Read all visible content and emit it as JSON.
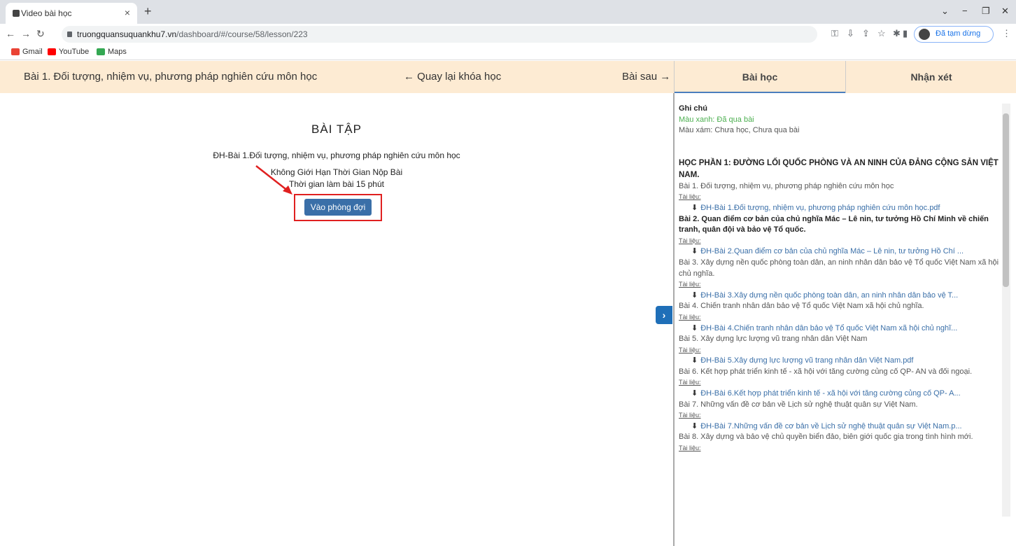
{
  "browser": {
    "tab_title": "Video bài học",
    "tab_close": "×",
    "new_tab": "+",
    "url_host": "truongquansuquankhu7.vn",
    "url_path": "/dashboard/#/course/58/lesson/223",
    "paused_label": "Đã tạm dừng",
    "bookmarks": [
      "Gmail",
      "YouTube",
      "Maps"
    ],
    "window_controls": [
      "⌄",
      "−",
      "❐",
      "✕"
    ]
  },
  "header": {
    "lesson_title": "Bài 1. Đối tượng, nhiệm vụ, phương pháp nghiên cứu môn học",
    "back_label": "← Quay lại khóa học",
    "next_label": "Bài sau →"
  },
  "right_tabs": {
    "lesson": "Bài học",
    "comments": "Nhận xét"
  },
  "exercise": {
    "heading": "BÀI TẬP",
    "name": "ĐH-Bài 1.Đối tượng, nhiệm vụ, phương pháp nghiên cứu môn học",
    "limit": "Không Giới Hạn Thời Gian Nộp Bài",
    "duration": "Thời gian làm bài 15 phút",
    "enter_button": "Vào phòng đợi"
  },
  "panel": {
    "note_title": "Ghi chú",
    "note_green": "Màu xanh: Đã qua bài",
    "note_gray": "Màu xám: Chưa học, Chưa qua bài",
    "module": "HỌC PHẦN 1: ĐƯỜNG LỐI QUỐC PHÒNG VÀ AN NINH CỦA ĐẢNG CỘNG SẢN VIỆT NAM.",
    "doc_label": "Tài liệu:",
    "lessons": [
      {
        "title": "Bài 1. Đối tượng, nhiệm vụ, phương pháp nghiên cứu môn học",
        "file": "ĐH-Bài 1.Đối tượng, nhiệm vụ, phương pháp nghiên cứu môn học.pdf"
      },
      {
        "title": "Bài 2. Quan điểm cơ bản của chủ nghĩa Mác – Lê nin, tư tưởng Hồ Chí Minh về chiến tranh, quân đội và bảo vệ Tổ quốc.",
        "file": "ĐH-Bài 2.Quan điểm cơ bản của chủ nghĩa Mác – Lê nin, tư tưởng Hồ Chí ..."
      },
      {
        "title": "Bài 3. Xây dựng nền quốc phòng toàn dân, an ninh nhân dân bảo vệ Tổ quốc Việt Nam xã hội chủ nghĩa.",
        "file": "ĐH-Bài 3.Xây dựng nền quốc phòng toàn dân, an ninh nhân dân bảo vệ T..."
      },
      {
        "title": "Bài 4. Chiến tranh nhân dân bảo vệ Tổ quốc Việt Nam xã hội chủ nghĩa.",
        "file": "ĐH-Bài 4.Chiến tranh nhân dân bảo vệ Tổ quốc Việt Nam xã hội chủ nghĩ..."
      },
      {
        "title": "Bài 5. Xây dựng lực lượng vũ trang nhân dân Việt Nam",
        "file": "ĐH-Bài 5.Xây dựng lực lượng vũ trang nhân dân Việt Nam.pdf"
      },
      {
        "title": "Bài 6. Kết hợp phát triển kinh tế - xã hội với tăng cường củng cố QP- AN và đối ngoại.",
        "file": "ĐH-Bài 6.Kết hợp phát triển kinh tế - xã hội với tăng cường củng cố QP- A..."
      },
      {
        "title": "Bài 7. Những vấn đề cơ bản về Lịch sử nghệ thuật quân sự Việt Nam.",
        "file": "ĐH-Bài 7.Những vấn đề cơ bản về Lịch sử nghệ thuật quân sự Việt Nam.p..."
      },
      {
        "title": "Bài 8. Xây dựng và bảo vệ chủ quyền biển đảo, biên giới quốc gia trong tình hình mới.",
        "file": ""
      }
    ]
  }
}
